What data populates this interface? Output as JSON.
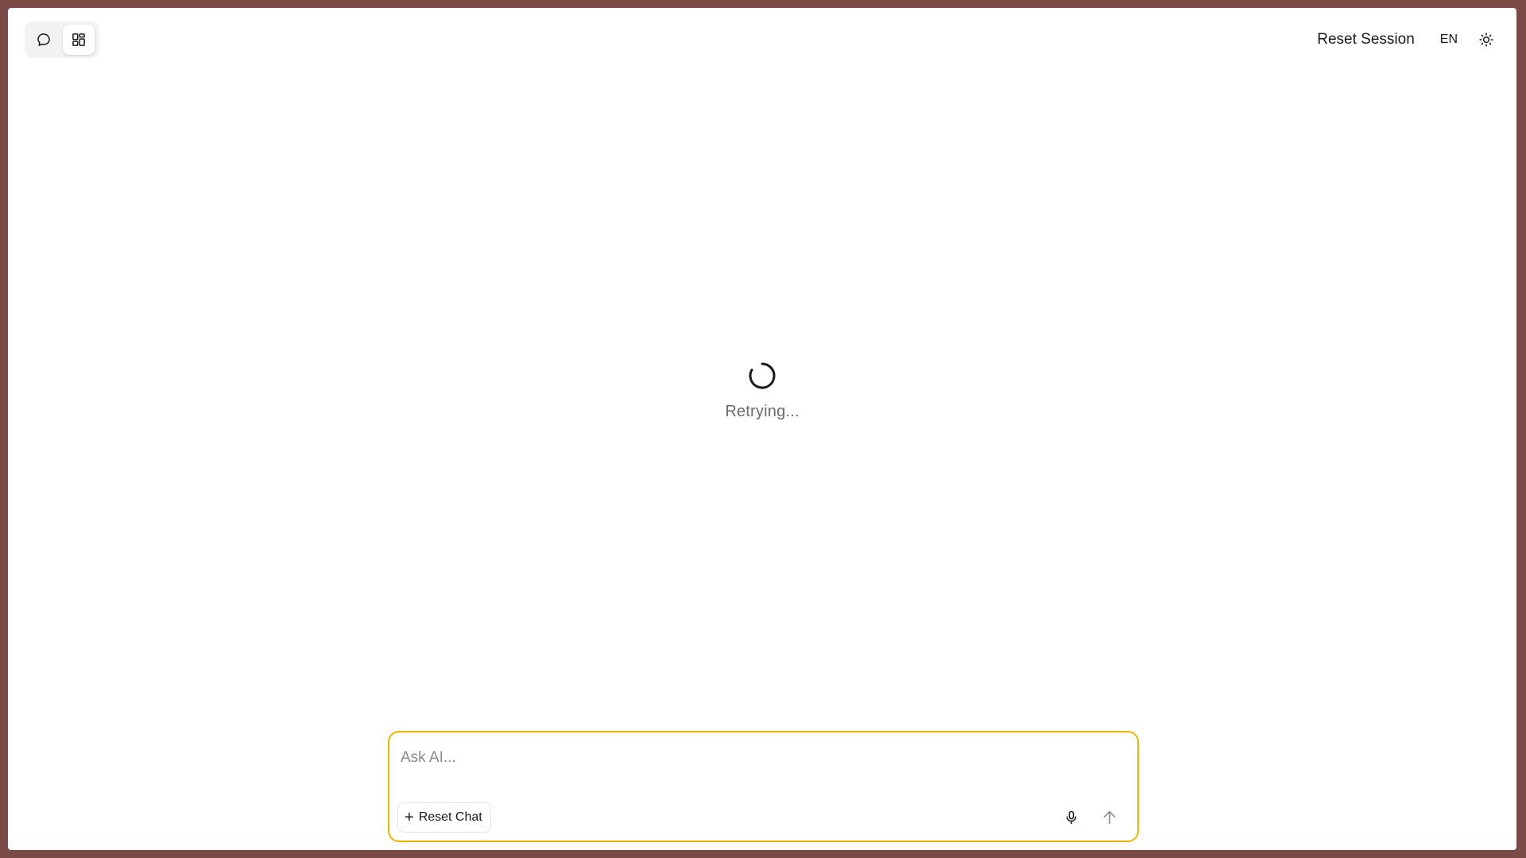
{
  "toolbar": {
    "views": [
      {
        "name": "chat",
        "icon": "chat-bubble-icon",
        "active": false
      },
      {
        "name": "dashboard",
        "icon": "dashboard-grid-icon",
        "active": true
      }
    ]
  },
  "header": {
    "reset_session_label": "Reset Session",
    "language": "EN",
    "theme_icon": "sun-icon"
  },
  "status": {
    "text": "Retrying...",
    "spinner_icon": "loading-spinner-icon"
  },
  "composer": {
    "placeholder": "Ask AI...",
    "value": "",
    "reset_chat_label": "Reset Chat",
    "reset_chat_icon": "plus-icon",
    "mic_icon": "microphone-icon",
    "send_icon": "arrow-up-icon",
    "accent_color": "#f0b400"
  },
  "colors": {
    "background": "#7a4a46",
    "window": "#ffffff",
    "muted_text": "#6b6b6b"
  }
}
